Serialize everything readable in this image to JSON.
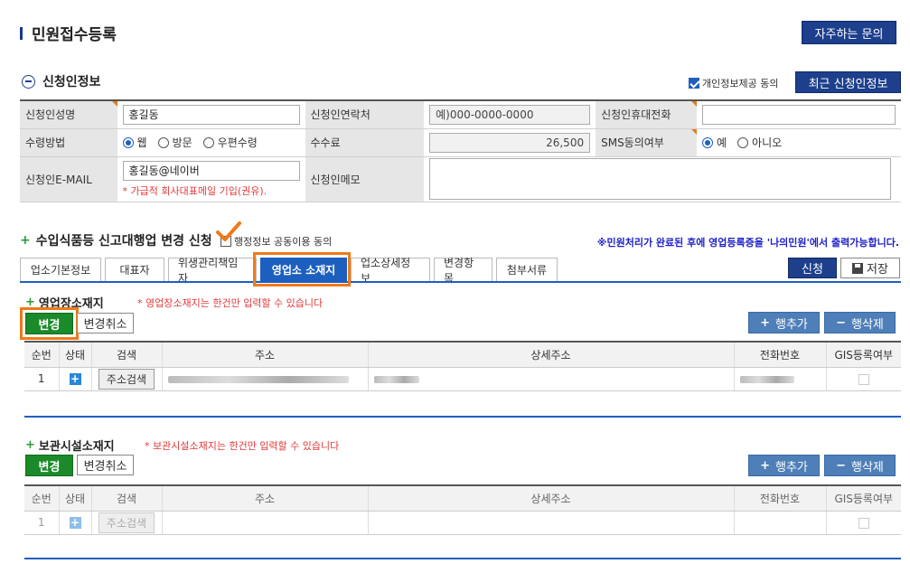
{
  "page_title": "민원접수등록",
  "faq_button": "자주하는 문의",
  "applicant_section": {
    "title": "신청인정보",
    "consent_label": "개인정보제공 동의",
    "consent_checked": true,
    "recent_button": "최근 신청인정보"
  },
  "form": {
    "name_label": "신청인성명",
    "name_value": "홍길동",
    "contact_label": "신청인연락처",
    "contact_placeholder": "예)000-0000-0000",
    "mobile_label": "신청인휴대전화",
    "receive_label": "수령방법",
    "receive_options": [
      "웹",
      "방문",
      "우편수령"
    ],
    "fee_label": "수수료",
    "fee_value": "26,500",
    "sms_label": "SMS동의여부",
    "sms_options": [
      "예",
      "아니오"
    ],
    "email_label": "신청인E-MAIL",
    "email_value": "홍길동@네이버",
    "email_note": "* 가급적 회사대표메일 기입(권유).",
    "memo_label": "신청인메모"
  },
  "change_section": {
    "title": "수입식품등 신고대행업 변경 신청",
    "share_label": "행정정보 공동이용 동의",
    "notice": "※민원처리가 완료된 후에 영업등록증을 '나의민원'에서 출력가능합니다."
  },
  "tabs": [
    "업소기본정보",
    "대표자",
    "위생관리책임자",
    "영업소 소재지",
    "업소상세정보",
    "변경항목",
    "첨부서류"
  ],
  "apply_button": "신청",
  "save_button": "저장",
  "business_location": {
    "title": "영업장소재지",
    "note": "* 영업장소재지는 한건만 입력할 수 있습니다",
    "change_button": "변경",
    "cancel_button": "변경취소",
    "add_row": "행추가",
    "del_row": "행삭제",
    "columns": [
      "순번",
      "상태",
      "검색",
      "주소",
      "상세주소",
      "전화번호",
      "GIS등록여부"
    ],
    "row": {
      "no": "1",
      "search": "주소검색"
    }
  },
  "storage_location": {
    "title": "보관시설소재지",
    "note": "* 보관시설소재지는 한건만 입력할 수 있습니다",
    "change_button": "변경",
    "cancel_button": "변경취소",
    "add_row": "행추가",
    "del_row": "행삭제",
    "columns": [
      "순번",
      "상태",
      "검색",
      "주소",
      "상세주소",
      "전화번호",
      "GIS등록여부"
    ],
    "row": {
      "no": "1",
      "search": "주소검색"
    }
  }
}
